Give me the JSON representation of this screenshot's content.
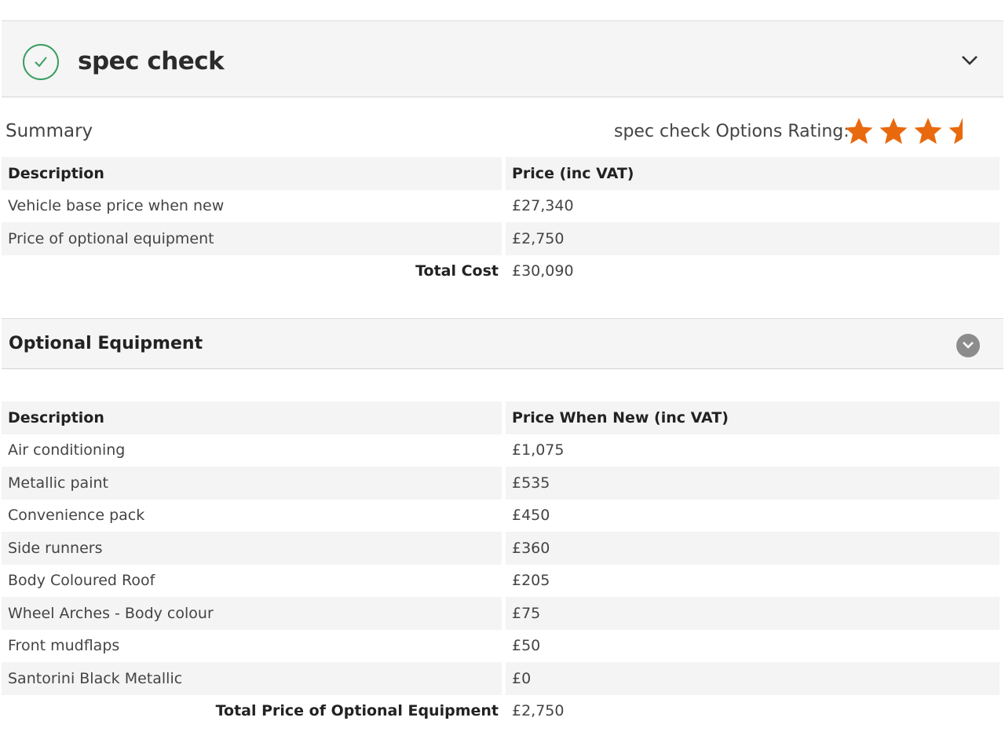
{
  "header": {
    "title": "spec check",
    "status_icon": "check-circle-icon",
    "toggle_icon": "chevron-down-icon",
    "accent_color": "#3a9e5f"
  },
  "summary": {
    "label": "Summary",
    "rating_label": "spec check Options Rating:",
    "rating": {
      "value": 3.5,
      "max": 4,
      "star_color": "#e8690e"
    },
    "columns": [
      "Description",
      "Price (inc VAT)"
    ],
    "rows": [
      {
        "description": "Vehicle base price when new",
        "price": "£27,340"
      },
      {
        "description": "Price of optional equipment",
        "price": "£2,750"
      }
    ],
    "total": {
      "label": "Total Cost",
      "value": "£30,090"
    }
  },
  "optional_equipment": {
    "title": "Optional Equipment",
    "toggle_icon": "chevron-down-circle-icon",
    "columns": [
      "Description",
      "Price When New (inc VAT)"
    ],
    "rows": [
      {
        "description": "Air conditioning",
        "price": "£1,075"
      },
      {
        "description": "Metallic paint",
        "price": "£535"
      },
      {
        "description": "Convenience pack",
        "price": "£450"
      },
      {
        "description": "Side runners",
        "price": "£360"
      },
      {
        "description": "Body Coloured Roof",
        "price": "£205"
      },
      {
        "description": "Wheel Arches - Body colour",
        "price": "£75"
      },
      {
        "description": "Front mudflaps",
        "price": "£50"
      },
      {
        "description": "Santorini Black Metallic",
        "price": "£0"
      }
    ],
    "total": {
      "label": "Total Price of Optional Equipment",
      "value": "£2,750"
    }
  }
}
